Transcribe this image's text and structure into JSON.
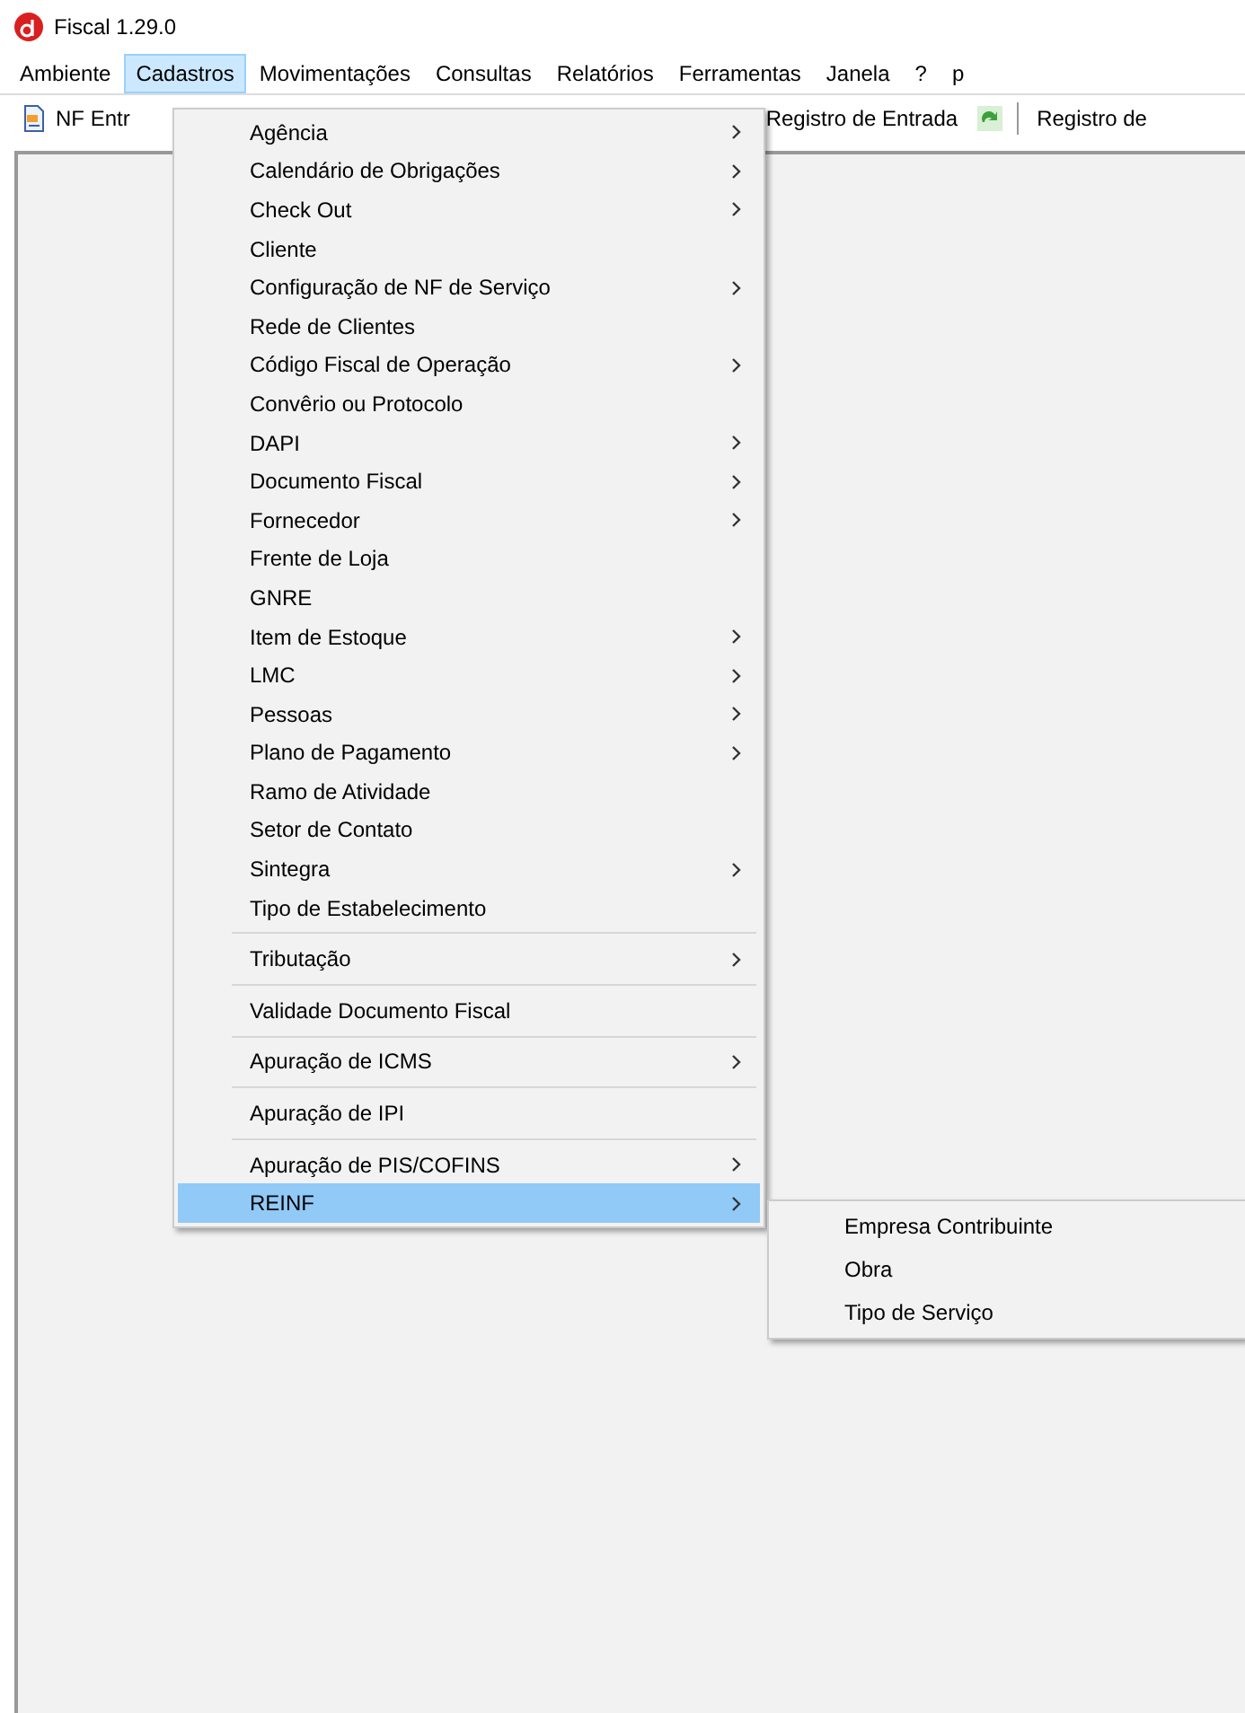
{
  "window": {
    "title": "Fiscal 1.29.0"
  },
  "menubar": [
    {
      "label": "Ambiente",
      "selected": false
    },
    {
      "label": "Cadastros",
      "selected": true
    },
    {
      "label": "Movimentações",
      "selected": false
    },
    {
      "label": "Consultas",
      "selected": false
    },
    {
      "label": "Relatórios",
      "selected": false
    },
    {
      "label": "Ferramentas",
      "selected": false
    },
    {
      "label": "Janela",
      "selected": false
    },
    {
      "label": "?",
      "selected": false
    },
    {
      "label": "p",
      "selected": false
    }
  ],
  "toolbar": [
    {
      "kind": "button",
      "label": "NF Entr"
    },
    {
      "kind": "button",
      "label": "Registro de Entrada"
    },
    {
      "kind": "button",
      "label": "Registro de"
    }
  ],
  "menu": [
    {
      "kind": "item",
      "label": "Agência",
      "submenu": true,
      "selected": false
    },
    {
      "kind": "item",
      "label": "Calendário de Obrigações",
      "submenu": true,
      "selected": false
    },
    {
      "kind": "item",
      "label": "Check Out",
      "submenu": true,
      "selected": false
    },
    {
      "kind": "item",
      "label": "Cliente",
      "submenu": false,
      "selected": false
    },
    {
      "kind": "item",
      "label": "Configuração de NF de Serviço",
      "submenu": true,
      "selected": false
    },
    {
      "kind": "item",
      "label": "Rede de Clientes",
      "submenu": false,
      "selected": false
    },
    {
      "kind": "item",
      "label": "Código Fiscal de Operação",
      "submenu": true,
      "selected": false
    },
    {
      "kind": "item",
      "label": "Convêrio ou Protocolo",
      "submenu": false,
      "selected": false
    },
    {
      "kind": "item",
      "label": "DAPI",
      "submenu": true,
      "selected": false
    },
    {
      "kind": "item",
      "label": "Documento Fiscal",
      "submenu": true,
      "selected": false
    },
    {
      "kind": "item",
      "label": "Fornecedor",
      "submenu": true,
      "selected": false
    },
    {
      "kind": "item",
      "label": "Frente de Loja",
      "submenu": false,
      "selected": false
    },
    {
      "kind": "item",
      "label": "GNRE",
      "submenu": false,
      "selected": false
    },
    {
      "kind": "item",
      "label": "Item de Estoque",
      "submenu": true,
      "selected": false
    },
    {
      "kind": "item",
      "label": "LMC",
      "submenu": true,
      "selected": false
    },
    {
      "kind": "item",
      "label": "Pessoas",
      "submenu": true,
      "selected": false
    },
    {
      "kind": "item",
      "label": "Plano de Pagamento",
      "submenu": true,
      "selected": false
    },
    {
      "kind": "item",
      "label": "Ramo de Atividade",
      "submenu": false,
      "selected": false
    },
    {
      "kind": "item",
      "label": "Setor de Contato",
      "submenu": false,
      "selected": false
    },
    {
      "kind": "item",
      "label": "Sintegra",
      "submenu": true,
      "selected": false
    },
    {
      "kind": "item",
      "label": "Tipo de Estabelecimento",
      "submenu": false,
      "selected": false
    },
    {
      "kind": "separator"
    },
    {
      "kind": "item",
      "label": "Tributação",
      "submenu": true,
      "selected": false
    },
    {
      "kind": "separator"
    },
    {
      "kind": "item",
      "label": "Validade Documento Fiscal",
      "submenu": false,
      "selected": false
    },
    {
      "kind": "separator"
    },
    {
      "kind": "item",
      "label": "Apuração de ICMS",
      "submenu": true,
      "selected": false
    },
    {
      "kind": "separator"
    },
    {
      "kind": "item",
      "label": "Apuração de IPI",
      "submenu": false,
      "selected": false
    },
    {
      "kind": "separator"
    },
    {
      "kind": "item",
      "label": "Apuração de PIS/COFINS",
      "submenu": true,
      "selected": false
    },
    {
      "kind": "item",
      "label": "REINF",
      "submenu": true,
      "selected": true
    }
  ],
  "submenu": [
    {
      "label": "Empresa Contribuinte",
      "selected": false
    },
    {
      "label": "Obra",
      "selected": false
    },
    {
      "label": "Tipo de Serviço",
      "selected": false
    }
  ]
}
